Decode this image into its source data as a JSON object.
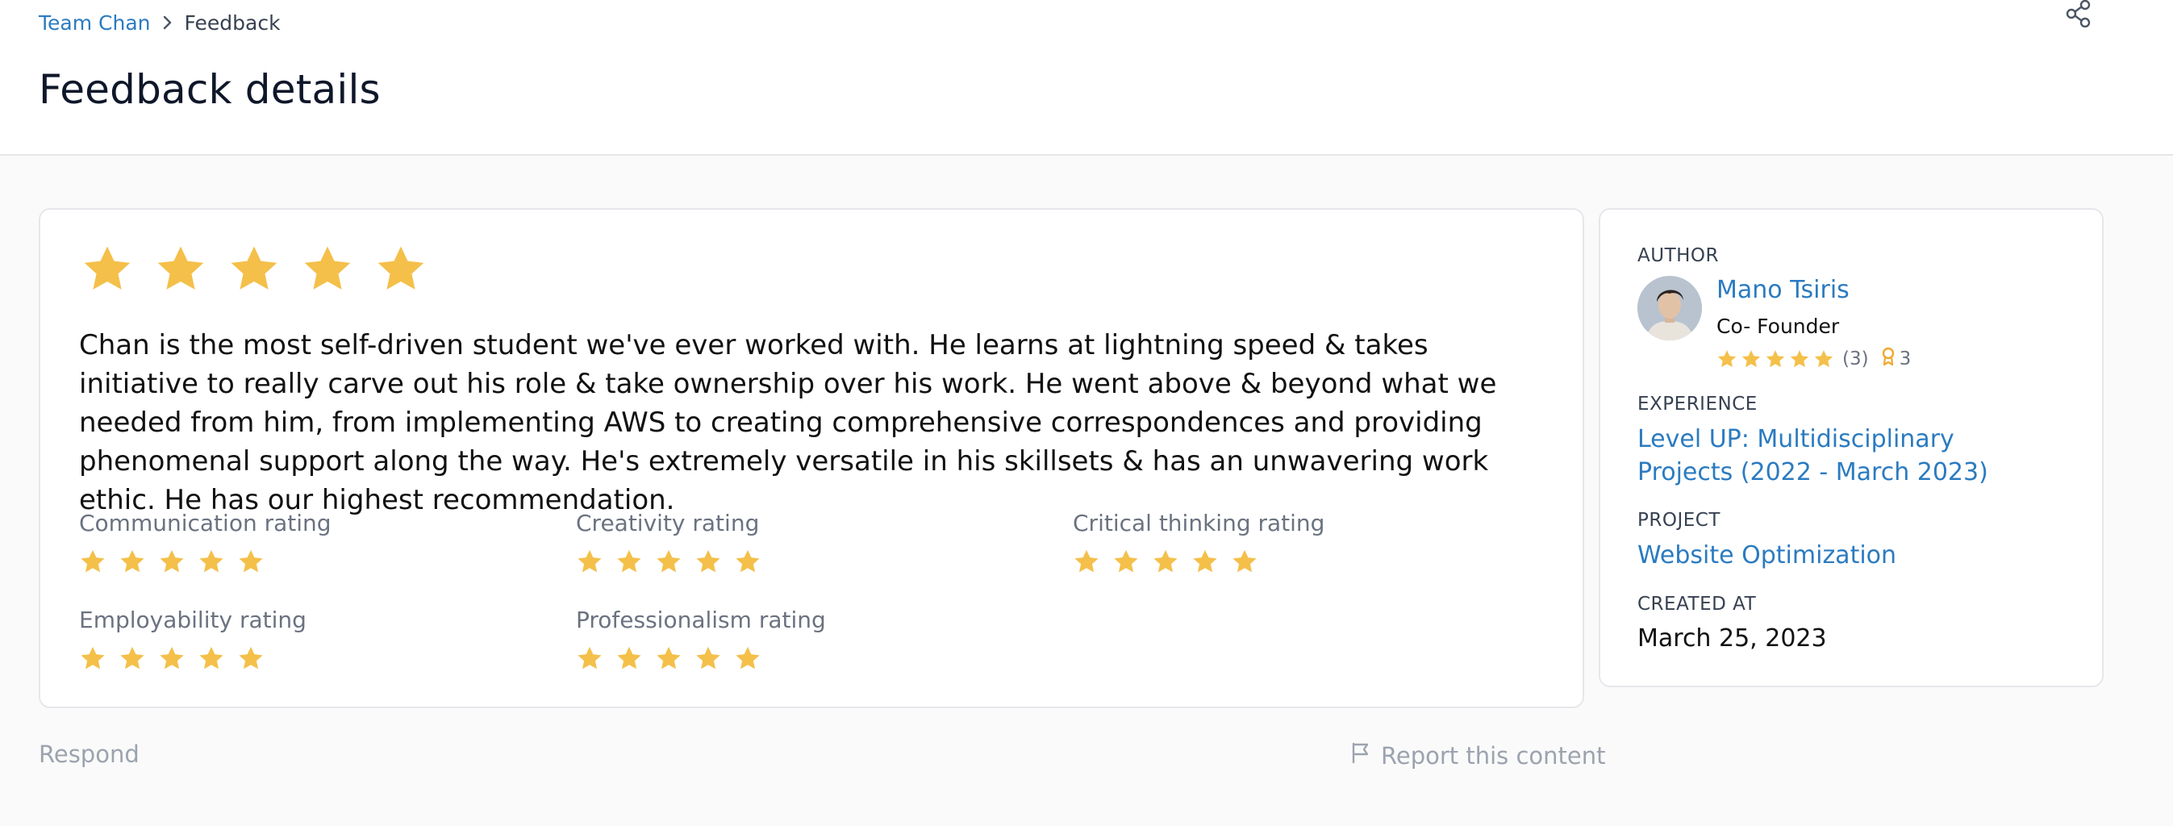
{
  "breadcrumb": {
    "parent": "Team Chan",
    "current": "Feedback"
  },
  "page": {
    "title": "Feedback details"
  },
  "icons": {
    "share": "share-icon",
    "chevron": "chevron-right-icon",
    "flag": "flag-icon",
    "star": "star-icon",
    "award": "award-icon"
  },
  "colors": {
    "star": "#F4C04A",
    "link": "#2B7BC0",
    "muted": "#6B7280"
  },
  "feedback": {
    "overall_rating": 5,
    "text": "Chan is the most self-driven student we've ever worked with. He learns at lightning speed & takes initiative to really carve out his role & take ownership over his work. He went above & beyond what we needed from him, from implementing AWS to creating comprehensive correspondences and providing phenomenal support along the way. He's extremely versatile in his skillsets & has an unwavering work ethic. He has our highest recommendation.",
    "ratings": [
      {
        "label": "Communication rating",
        "value": 5
      },
      {
        "label": "Creativity rating",
        "value": 5
      },
      {
        "label": "Critical thinking rating",
        "value": 5
      },
      {
        "label": "Employability rating",
        "value": 5
      },
      {
        "label": "Professionalism rating",
        "value": 5
      }
    ]
  },
  "actions": {
    "respond": "Respond",
    "report": "Report this content"
  },
  "sidebar": {
    "author_label": "AUTHOR",
    "author": {
      "name": "Mano Tsiris",
      "role": "Co- Founder",
      "rating": 5,
      "review_count": "(3)",
      "badge_count": "3"
    },
    "experience_label": "EXPERIENCE",
    "experience": "Level UP: Multidisciplinary Projects (2022 - March 2023)",
    "project_label": "PROJECT",
    "project": "Website Optimization",
    "created_label": "CREATED AT",
    "created": "March 25, 2023"
  }
}
